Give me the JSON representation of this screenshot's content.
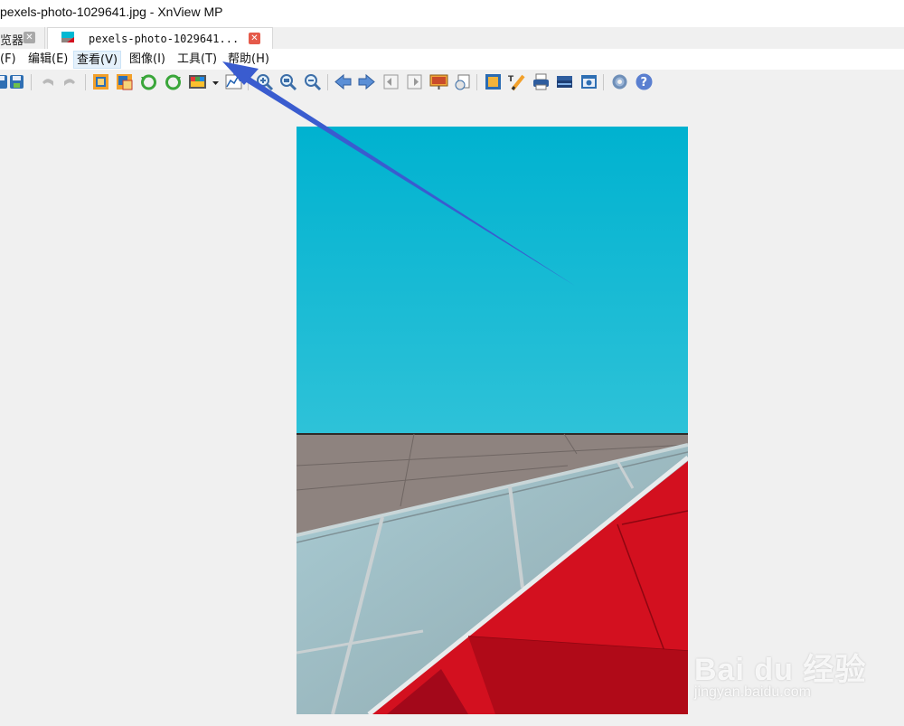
{
  "window": {
    "title": "pexels-photo-1029641.jpg - XnView MP"
  },
  "tabs": [
    {
      "label": "览器",
      "active": false
    },
    {
      "label": "pexels-photo-1029641...",
      "active": true
    }
  ],
  "menu": [
    {
      "label": "(F)"
    },
    {
      "label": "编辑(E)"
    },
    {
      "label": "查看(V)"
    },
    {
      "label": "图像(I)"
    },
    {
      "label": "工具(T)"
    },
    {
      "label": "帮助(H)"
    }
  ],
  "toolbar_icons": [
    "save-icon",
    "save-as-icon",
    "undo-icon",
    "redo-icon",
    "crop-icon",
    "resize-icon",
    "rotate-left-icon",
    "rotate-right-icon",
    "color-adjust-icon",
    "dropdown-arrow-icon",
    "histogram-icon",
    "zoom-in-icon",
    "zoom-fit-icon",
    "zoom-out-icon",
    "previous-icon",
    "next-icon",
    "first-icon",
    "last-icon",
    "slideshow-icon",
    "copy-icon",
    "fullscreen-icon",
    "edit-icon",
    "print-icon",
    "scanner-icon",
    "capture-icon",
    "settings-icon",
    "help-icon"
  ],
  "colors": {
    "sky": "#00b8d3",
    "wall": "#8e837f",
    "red": "#d3101f",
    "arrow": "#3a5ccf",
    "menu_active_bg": "#e5f1fb"
  },
  "watermark": {
    "brand": "Bai du 经验",
    "url": "jingyan.baidu.com"
  }
}
